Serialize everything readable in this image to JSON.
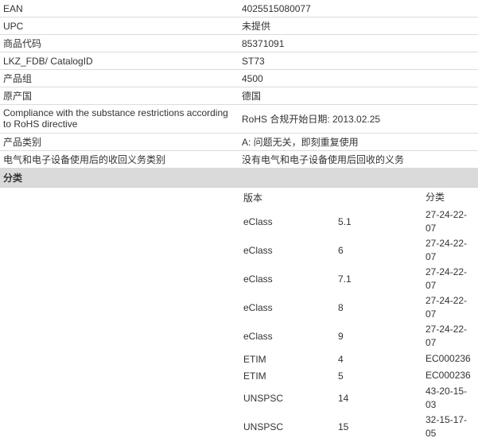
{
  "properties": [
    {
      "label": "EAN",
      "value": "4025515080077"
    },
    {
      "label": "UPC",
      "value": "未提供"
    },
    {
      "label": "商品代码",
      "value": "85371091"
    },
    {
      "label": "LKZ_FDB/ CatalogID",
      "value": "ST73"
    },
    {
      "label": "产品组",
      "value": "4500"
    },
    {
      "label": "原产国",
      "value": "德国"
    },
    {
      "label": "Compliance with the substance restrictions according to RoHS directive",
      "value": "RoHS 合规开始日期: 2013.02.25"
    },
    {
      "label": "产品类别",
      "value": "A: 问题无关，即刻重复使用"
    },
    {
      "label": "电气和电子设备使用后的收回义务类别",
      "value": "没有电气和电子设备使用后回收的义务"
    }
  ],
  "classification": {
    "title": "分类",
    "headers": {
      "version": "版本",
      "class": "分类"
    },
    "rows": [
      {
        "system": "eClass",
        "version": "5.1",
        "class_line1": "27-24-22-",
        "class_line2": "07"
      },
      {
        "system": "eClass",
        "version": "6",
        "class_line1": "27-24-22-",
        "class_line2": "07"
      },
      {
        "system": "eClass",
        "version": "7.1",
        "class_line1": "27-24-22-",
        "class_line2": "07"
      },
      {
        "system": "eClass",
        "version": "8",
        "class_line1": "27-24-22-",
        "class_line2": "07"
      },
      {
        "system": "eClass",
        "version": "9",
        "class_line1": "27-24-22-",
        "class_line2": "07"
      },
      {
        "system": "ETIM",
        "version": "4",
        "class_line1": "EC000236",
        "class_line2": ""
      },
      {
        "system": "ETIM",
        "version": "5",
        "class_line1": "EC000236",
        "class_line2": ""
      },
      {
        "system": "UNSPSC",
        "version": "14",
        "class_line1": "43-20-15-",
        "class_line2": "03"
      },
      {
        "system": "UNSPSC",
        "version": "15",
        "class_line1": "32-15-17-",
        "class_line2": "05"
      }
    ]
  }
}
